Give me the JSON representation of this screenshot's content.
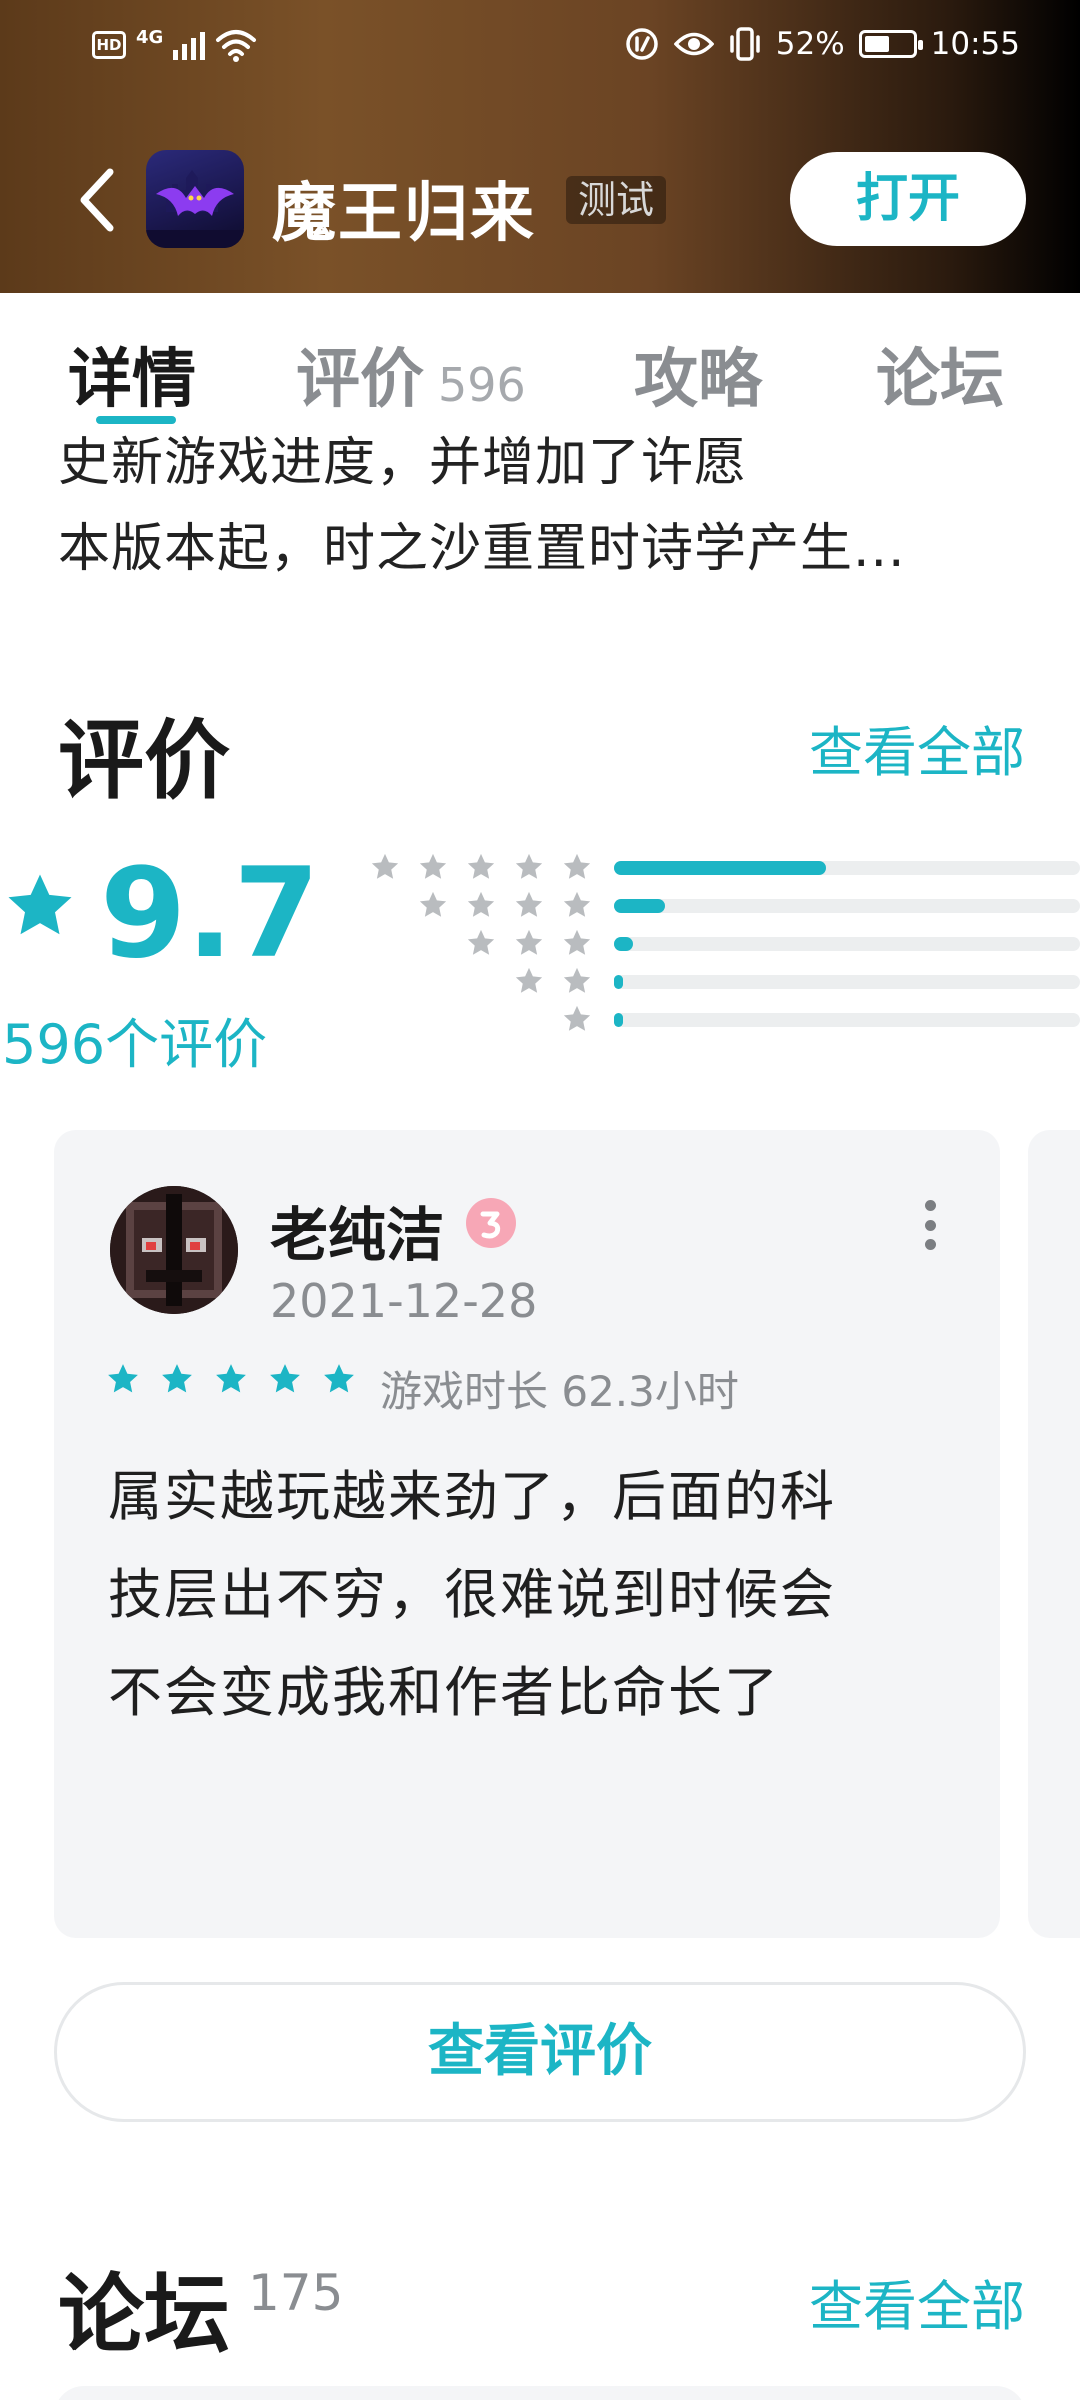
{
  "status_bar": {
    "hd": "HD",
    "network": "4G",
    "battery": "52%",
    "battery_level": 0.52,
    "time": "10:55"
  },
  "header": {
    "app_title": "魔王归来",
    "tag": "测试",
    "open_label": "打开",
    "back_icon": "chevron-left-icon"
  },
  "tabs": [
    {
      "label": "详情",
      "active": true
    },
    {
      "label": "评价",
      "count": "596"
    },
    {
      "label": "攻略"
    },
    {
      "label": "论坛"
    }
  ],
  "description": {
    "lines": [
      "史新游戏进度，并增加了许愿",
      "本版本起，时之沙重置时诗学产生..."
    ]
  },
  "rating_section": {
    "title": "评价",
    "see_all": "查看全部",
    "score": "9.7",
    "count_label": "596个评价",
    "distribution": [
      {
        "stars": 5,
        "fraction": 0.455
      },
      {
        "stars": 4,
        "fraction": 0.11
      },
      {
        "stars": 3,
        "fraction": 0.04
      },
      {
        "stars": 2,
        "fraction": 0.02
      },
      {
        "stars": 1,
        "fraction": 0.02
      }
    ]
  },
  "review": {
    "name": "老纯洁",
    "date": "2021-12-28",
    "stars": 5,
    "playtime": "游戏时长 62.3小时",
    "lines": [
      "属实越玩越来劲了，后面的科",
      "技层出不穷，很难说到时候会",
      "不会变成我和作者比命长了"
    ],
    "view_label": "查看评价"
  },
  "forum": {
    "title": "论坛",
    "count": "175",
    "see_all": "查看全部"
  },
  "colors": {
    "accent": "#1cb5c5",
    "text": "#1a1a1a",
    "muted": "#8a8d91",
    "card_bg": "#f4f5f7",
    "star_gray": "#b9bcbf"
  }
}
